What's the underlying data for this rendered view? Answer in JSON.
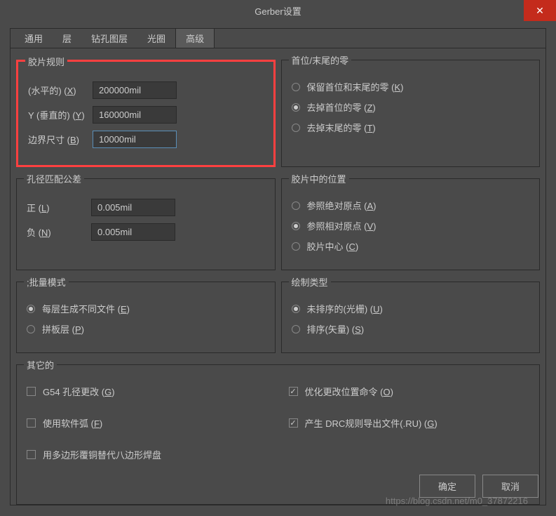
{
  "window": {
    "title": "Gerber设置",
    "close": "✕"
  },
  "tabs": {
    "general": "通用",
    "layers": "层",
    "drill": "钻孔图层",
    "aperture": "光圈",
    "advanced": "高级"
  },
  "groups": {
    "film_rules": {
      "title": "胶片规则",
      "horizontal_label": "(水平的) (X)",
      "horizontal_value": "200000mil",
      "vertical_label": "Y (垂直的) (Y)",
      "vertical_value": "160000mil",
      "border_label": "边界尺寸 (B)",
      "border_value": "10000mil"
    },
    "leading_trailing": {
      "title": "首位/末尾的零",
      "keep": "保留首位和末尾的零 (K)",
      "strip_leading": "去掉首位的零 (Z)",
      "strip_trailing": "去掉末尾的零 (T)"
    },
    "aperture_tol": {
      "title": "孔径匹配公差",
      "pos_label": "正 (L)",
      "pos_value": "0.005mil",
      "neg_label": "负 (N)",
      "neg_value": "0.005mil"
    },
    "film_position": {
      "title": "胶片中的位置",
      "abs": "参照绝对原点 (A)",
      "rel": "参照相对原点 (V)",
      "center": "胶片中心 (C)"
    },
    "batch_mode": {
      "title": ";批量模式",
      "per_layer": "每层生成不同文件 (E)",
      "panel": "拼板层 (P)"
    },
    "plot_type": {
      "title": "绘制类型",
      "unsorted": "未排序的(光栅) (U)",
      "sorted": "排序(矢量) (S)"
    },
    "other": {
      "title": "其它的",
      "g54": "G54 孔径更改 (G)",
      "soft_arc": "使用软件弧 (F)",
      "octagon": "用多边形覆铜替代八边形焊盘",
      "optimize": "优化更改位置命令 (O)",
      "drc_rules": "产生 DRC规则导出文件(.RU) (G)"
    }
  },
  "buttons": {
    "ok": "确定",
    "cancel": "取消"
  },
  "watermark": "https://blog.csdn.net/m0_37872216"
}
